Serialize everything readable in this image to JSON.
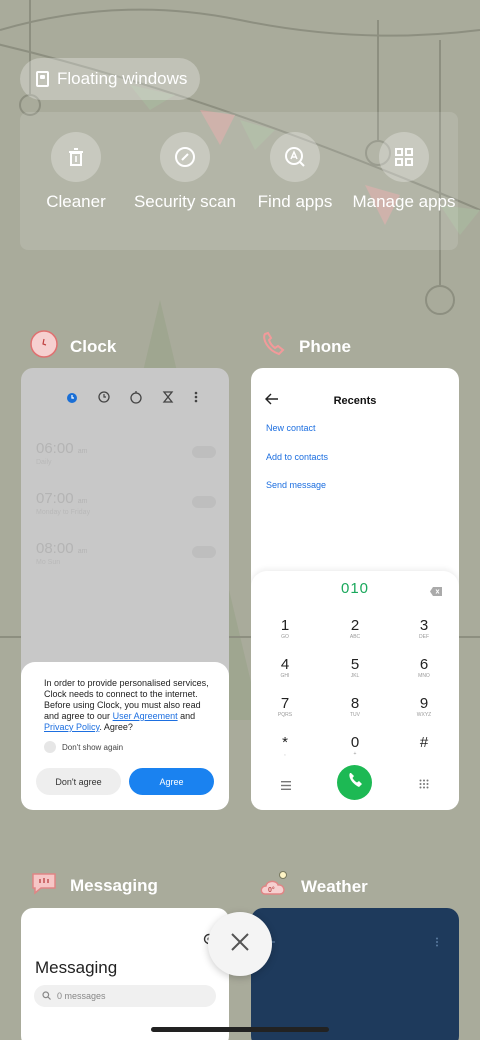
{
  "floating_windows": {
    "label": "Floating windows"
  },
  "tools": [
    {
      "label": "Cleaner",
      "icon": "trash-icon"
    },
    {
      "label": "Security scan",
      "icon": "shield-check-icon"
    },
    {
      "label": "Find apps",
      "icon": "search-app-icon"
    },
    {
      "label": "Manage apps",
      "icon": "grid-icon"
    }
  ],
  "apps": {
    "clock": {
      "title": "Clock",
      "alarms": [
        {
          "time": "06:00",
          "ampm": "am",
          "note": "Daily"
        },
        {
          "time": "07:00",
          "ampm": "am",
          "note": "Monday to Friday"
        },
        {
          "time": "08:00",
          "ampm": "am",
          "note": "Mo Sun"
        }
      ],
      "dialog": {
        "text": "In order to provide personalised services, Clock needs to connect to the internet. Before using Clock, you must also read and agree to our",
        "link1": "User Agreement",
        "and": "and",
        "link2": "Privacy Policy",
        "agree_q": ". Agree?",
        "checkbox": "Don't show again",
        "disagree": "Don't agree",
        "agree": "Agree"
      }
    },
    "phone": {
      "title": "Phone",
      "recents_title": "Recents",
      "links": [
        "New contact",
        "Add to contacts",
        "Send message"
      ],
      "dialed": "010",
      "keys": [
        {
          "d": "1",
          "l": "GO"
        },
        {
          "d": "2",
          "l": "ABC"
        },
        {
          "d": "3",
          "l": "DEF"
        },
        {
          "d": "4",
          "l": "GHI"
        },
        {
          "d": "5",
          "l": "JKL"
        },
        {
          "d": "6",
          "l": "MNO"
        },
        {
          "d": "7",
          "l": "PQRS"
        },
        {
          "d": "8",
          "l": "TUV"
        },
        {
          "d": "9",
          "l": "WXYZ"
        },
        {
          "d": "*",
          "l": ","
        },
        {
          "d": "0",
          "l": "+"
        },
        {
          "d": "#",
          "l": ""
        }
      ]
    },
    "messaging": {
      "title": "Messaging",
      "heading": "Messaging",
      "search_placeholder": "0 messages"
    },
    "weather": {
      "title": "Weather"
    }
  },
  "colors": {
    "accent_blue": "#1a82f0",
    "call_green": "#1db954",
    "dial_green": "#1aa85c"
  }
}
